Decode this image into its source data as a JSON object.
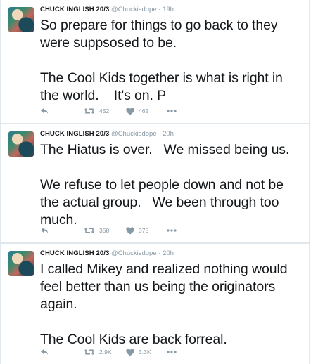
{
  "tweets": [
    {
      "name": "CHUCK INGLISH 20/3",
      "handle": "@Chuckisdope",
      "separator": "·",
      "time": "19h",
      "text": "So prepare for things to go back to they were suppsosed to be.\n\nThe Cool Kids together is what is right in the world.    It's on. P",
      "retweets": "452",
      "likes": "462"
    },
    {
      "name": "CHUCK INGLISH 20/3",
      "handle": "@Chuckisdope",
      "separator": "·",
      "time": "20h",
      "text": "The Hiatus is over.   We missed being us.\n\nWe refuse to let people down and not be the actual group.   We been through too much.",
      "retweets": "358",
      "likes": "375"
    },
    {
      "name": "CHUCK INGLISH 20/3",
      "handle": "@Chuckisdope",
      "separator": "·",
      "time": "20h",
      "text": "I called Mikey and realized nothing would feel better than us being the originators again.\n\nThe Cool Kids are back forreal.",
      "retweets": "2.9K",
      "likes": "3.3K"
    }
  ],
  "icons": {
    "reply": "reply-icon",
    "retweet": "retweet-icon",
    "like": "heart-icon",
    "more": "more-dots-icon"
  },
  "colors": {
    "text": "#14171a",
    "muted": "#8899a6",
    "border": "#e1e8ed"
  }
}
